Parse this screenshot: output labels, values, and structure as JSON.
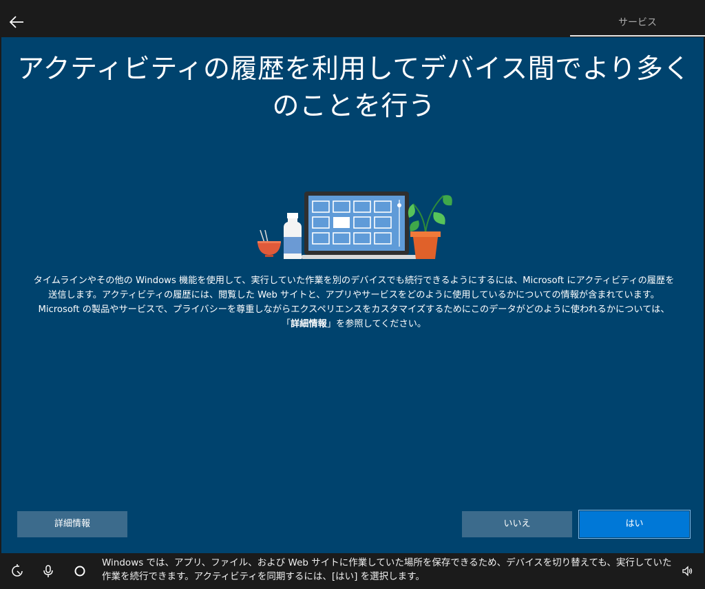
{
  "header": {
    "back_label": "back",
    "tab_label": "サービス"
  },
  "main": {
    "title": "アクティビティの履歴を利用してデバイス間でより多くのことを行う",
    "body_part1": "タイムラインやその他の Windows 機能を使用して、実行していた作業を別のデバイスでも続行できるようにするには、Microsoft にアクティビティの履歴を送信します。アクティビティの履歴には、閲覧した Web サイトと、アプリやサービスをどのように使用しているかについての情報が含まれています。Microsoft の製品やサービスで、プライバシーを尊重しながらエクスペリエンスをカスタマイズするためにこのデータがどのように使われるかについては、「",
    "body_link": "詳細情報",
    "body_part2": "」を参照してください。"
  },
  "buttons": {
    "learn_more": "詳細情報",
    "no": "いいえ",
    "yes": "はい"
  },
  "footer": {
    "narration": "Windows では、アプリ、ファイル、および Web サイトに作業していた場所を保存できるため、デバイスを切り替えても、実行していた作業を続行できます。アクティビティを同期するには、[はい] を選択します。",
    "icons": [
      "accessibility-icon",
      "microphone-icon",
      "cortana-icon",
      "volume-icon"
    ]
  },
  "colors": {
    "panel": "#00436e",
    "accent": "#0078d7",
    "secondary_button": "#3c6b8c",
    "chrome": "#1b1b1b"
  }
}
